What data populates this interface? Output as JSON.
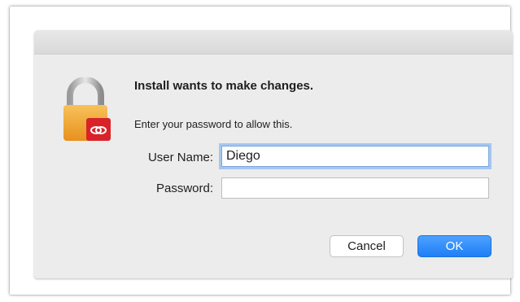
{
  "dialog": {
    "heading": "Install wants to make changes.",
    "subtext": "Enter your password to allow this.",
    "icon": "lock-icon",
    "badge_icon": "creative-cloud-icon"
  },
  "form": {
    "username_label": "User Name:",
    "username_value": "Diego",
    "password_label": "Password:",
    "password_value": ""
  },
  "buttons": {
    "cancel_label": "Cancel",
    "ok_label": "OK"
  },
  "colors": {
    "accent": "#1f7ff5",
    "lock_body": "#f2a63a",
    "badge": "#d8232a"
  }
}
